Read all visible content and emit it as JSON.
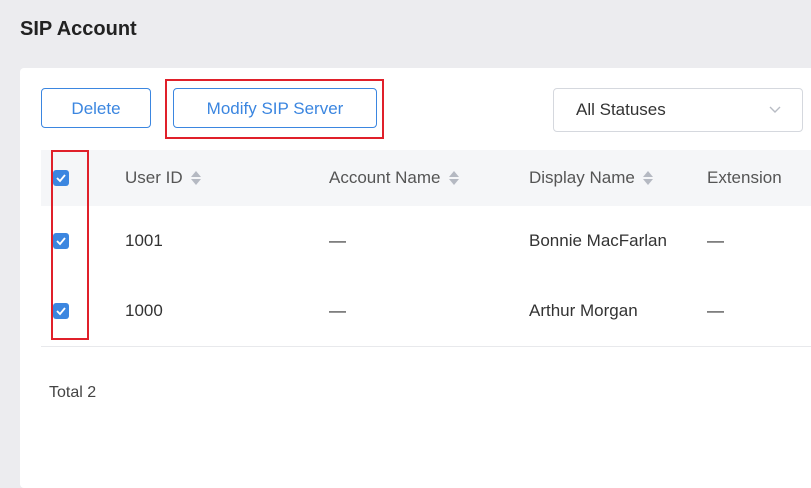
{
  "page": {
    "title": "SIP Account"
  },
  "toolbar": {
    "delete_label": "Delete",
    "modify_label": "Modify SIP Server",
    "status_select": {
      "value": "All Statuses"
    }
  },
  "table": {
    "columns": [
      "User ID",
      "Account Name",
      "Display Name",
      "Extension"
    ],
    "rows": [
      {
        "checked": true,
        "user_id": "1001",
        "account_name": "—",
        "display_name": "Bonnie MacFarlan",
        "extension": "—"
      },
      {
        "checked": true,
        "user_id": "1000",
        "account_name": "—",
        "display_name": "Arthur Morgan",
        "extension": "—"
      }
    ],
    "header_checked": true
  },
  "footer": {
    "total_text": "Total 2"
  },
  "icons": {
    "checkbox": "check-icon",
    "sort": "sort-icon",
    "dropdown": "chevron-down-icon"
  },
  "colors": {
    "accent": "#3b86e0",
    "highlight": "#e0202a",
    "background": "#ececef"
  }
}
